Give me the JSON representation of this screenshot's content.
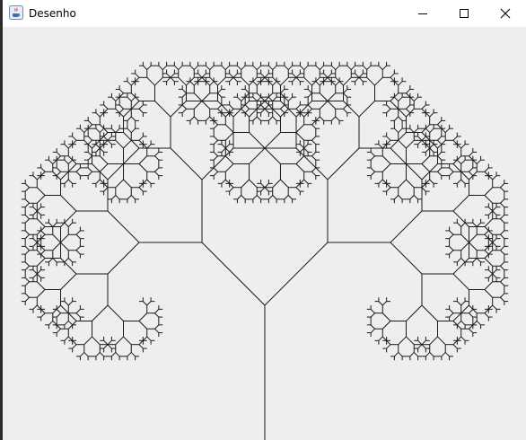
{
  "window": {
    "title": "Desenho",
    "app_icon": "java-coffee-cup-icon",
    "controls": [
      "minimize-icon",
      "maximize-icon",
      "close-icon"
    ]
  },
  "drawing": {
    "subject": "fractal-tree",
    "depth": 10,
    "branch_angle_deg": 45,
    "length_ratio": 0.707,
    "stroke_color": "#1a1a1a",
    "background_color": "#eeeeee"
  }
}
